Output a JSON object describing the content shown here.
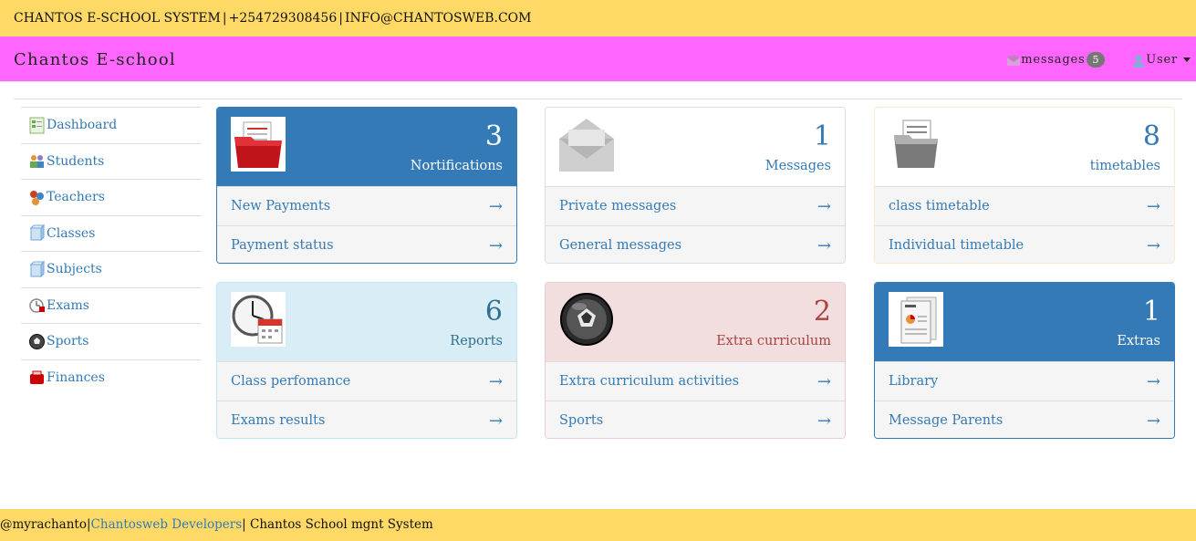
{
  "topbar": {
    "system_name": "CHANTOS E-SCHOOL SYSTEM",
    "separator": "|",
    "phone": "+254729308456",
    "email": "INFO@CHANTOSWEB.COM"
  },
  "navbar": {
    "brand": "Chantos E-school",
    "messages_label": "messages",
    "messages_count": "5",
    "user_label": "User"
  },
  "sidebar": {
    "items": [
      {
        "label": "Dashboard",
        "icon": "dashboard-icon"
      },
      {
        "label": "Students",
        "icon": "students-icon"
      },
      {
        "label": "Teachers",
        "icon": "teachers-icon"
      },
      {
        "label": "Classes",
        "icon": "classes-icon"
      },
      {
        "label": "Subjects",
        "icon": "subjects-icon"
      },
      {
        "label": "Exams",
        "icon": "exams-icon"
      },
      {
        "label": "Sports",
        "icon": "sports-icon"
      },
      {
        "label": "Finances",
        "icon": "finances-icon"
      }
    ]
  },
  "panels": [
    {
      "count": "3",
      "label": "Nortifications",
      "icon": "red-folder-icon",
      "style": "primary",
      "links": [
        "New Payments",
        "Payment status"
      ]
    },
    {
      "count": "1",
      "label": "Messages",
      "icon": "envelope-icon",
      "style": "default",
      "links": [
        "Private messages",
        "General messages"
      ]
    },
    {
      "count": "8",
      "label": "timetables",
      "icon": "grey-folder-icon",
      "style": "warning",
      "links": [
        "class timetable",
        "Individual timetable"
      ]
    },
    {
      "count": "6",
      "label": "Reports",
      "icon": "clock-calendar-icon",
      "style": "info",
      "links": [
        "Class perfomance",
        "Exams results"
      ]
    },
    {
      "count": "2",
      "label": "Extra curriculum",
      "icon": "soccer-ball-icon",
      "style": "danger",
      "links": [
        "Extra curriculum activities",
        "Sports"
      ]
    },
    {
      "count": "1",
      "label": "Extras",
      "icon": "documents-icon",
      "style": "primary",
      "links": [
        "Library",
        "Message Parents"
      ]
    }
  ],
  "arrow_glyph": "→",
  "footer": {
    "handle": "@myrachanto",
    "separator": "|",
    "developer_link": "Chantosweb Developers",
    "system_label": "Chantos School mgnt System"
  },
  "colors": {
    "topbar_bg": "#ffd966",
    "navbar_bg": "#ff66ff",
    "primary": "#337ab7",
    "info_bg": "#d9edf7",
    "danger_bg": "#f2dede",
    "danger_text": "#a94442"
  }
}
